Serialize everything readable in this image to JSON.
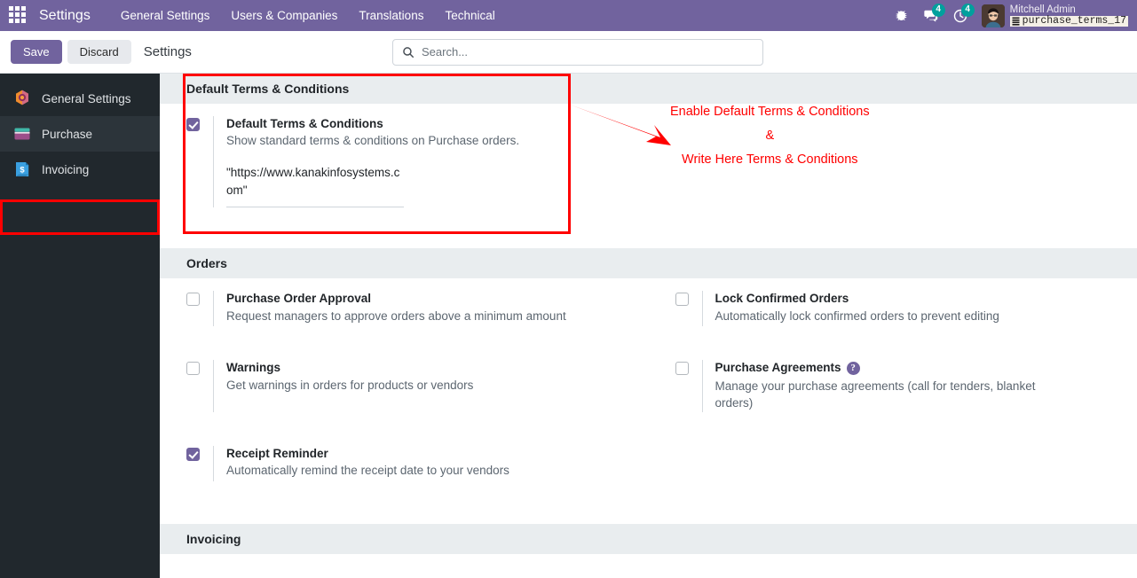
{
  "navbar": {
    "apps_icon": "apps-grid-icon",
    "brand": "Settings",
    "menu_items": [
      {
        "label": "General Settings",
        "name": "navbar-item-general-settings"
      },
      {
        "label": "Users & Companies",
        "name": "navbar-item-users-companies"
      },
      {
        "label": "Translations",
        "name": "navbar-item-translations"
      },
      {
        "label": "Technical",
        "name": "navbar-item-technical"
      }
    ],
    "sys_icons": [
      {
        "name": "bug-icon",
        "badge": ""
      },
      {
        "name": "messages-icon",
        "badge": "4"
      },
      {
        "name": "activities-clock-icon",
        "badge": "4"
      }
    ],
    "user": {
      "name": "Mitchell Admin",
      "database": "purchase_terms_17",
      "db_icon": "database-icon",
      "avatar_icon": "user-avatar"
    },
    "accent_color": "#71639e",
    "badge_color": "#00a09d"
  },
  "control_panel": {
    "save_label": "Save",
    "discard_label": "Discard",
    "title": "Settings",
    "search_placeholder": "Search...",
    "search_value": "",
    "search_icon": "search-icon"
  },
  "sidebar": {
    "items": [
      {
        "label": "General Settings",
        "name": "sidebar-item-general-settings",
        "icon": "settings-gear-icon",
        "active": false,
        "highlighted": false
      },
      {
        "label": "Purchase",
        "name": "sidebar-item-purchase",
        "icon": "purchase-card-icon",
        "active": true,
        "highlighted": true
      },
      {
        "label": "Invoicing",
        "name": "sidebar-item-invoicing",
        "icon": "invoicing-document-icon",
        "active": false,
        "highlighted": false
      }
    ]
  },
  "sections": {
    "terms": {
      "header": "Default Terms & Conditions",
      "setting": {
        "label": "Default Terms & Conditions",
        "description": "Show standard terms & conditions on Purchase orders.",
        "checked": true
      },
      "textarea_value": "\"https://www.kanakinfosystems.com\""
    },
    "orders": {
      "header": "Orders",
      "rows": [
        {
          "left": {
            "label": "Purchase Order Approval",
            "description": "Request managers to approve orders above a minimum amount",
            "checked": false,
            "help": false
          },
          "right": {
            "label": "Lock Confirmed Orders",
            "description": "Automatically lock confirmed orders to prevent editing",
            "checked": false,
            "help": false
          }
        },
        {
          "left": {
            "label": "Warnings",
            "description": "Get warnings in orders for products or vendors",
            "checked": false,
            "help": false
          },
          "right": {
            "label": "Purchase Agreements",
            "description": "Manage your purchase agreements (call for tenders, blanket orders)",
            "checked": false,
            "help": true,
            "help_icon": "help-question-icon",
            "help_glyph": "?"
          }
        },
        {
          "left": {
            "label": "Receipt Reminder",
            "description": "Automatically remind the receipt date to your vendors",
            "checked": true,
            "help": false
          },
          "right": null
        }
      ]
    },
    "invoicing": {
      "header": "Invoicing"
    }
  },
  "annotations": {
    "color": "#ff0000",
    "line1": "Enable Default Terms & Conditions",
    "line2": "&",
    "line3": "Write Here Terms & Conditions",
    "arrow_icon": "red-arrow-icon",
    "box_terms_name": "highlight-box-default-terms",
    "box_sidebar_name": "highlight-box-purchase-menu"
  }
}
